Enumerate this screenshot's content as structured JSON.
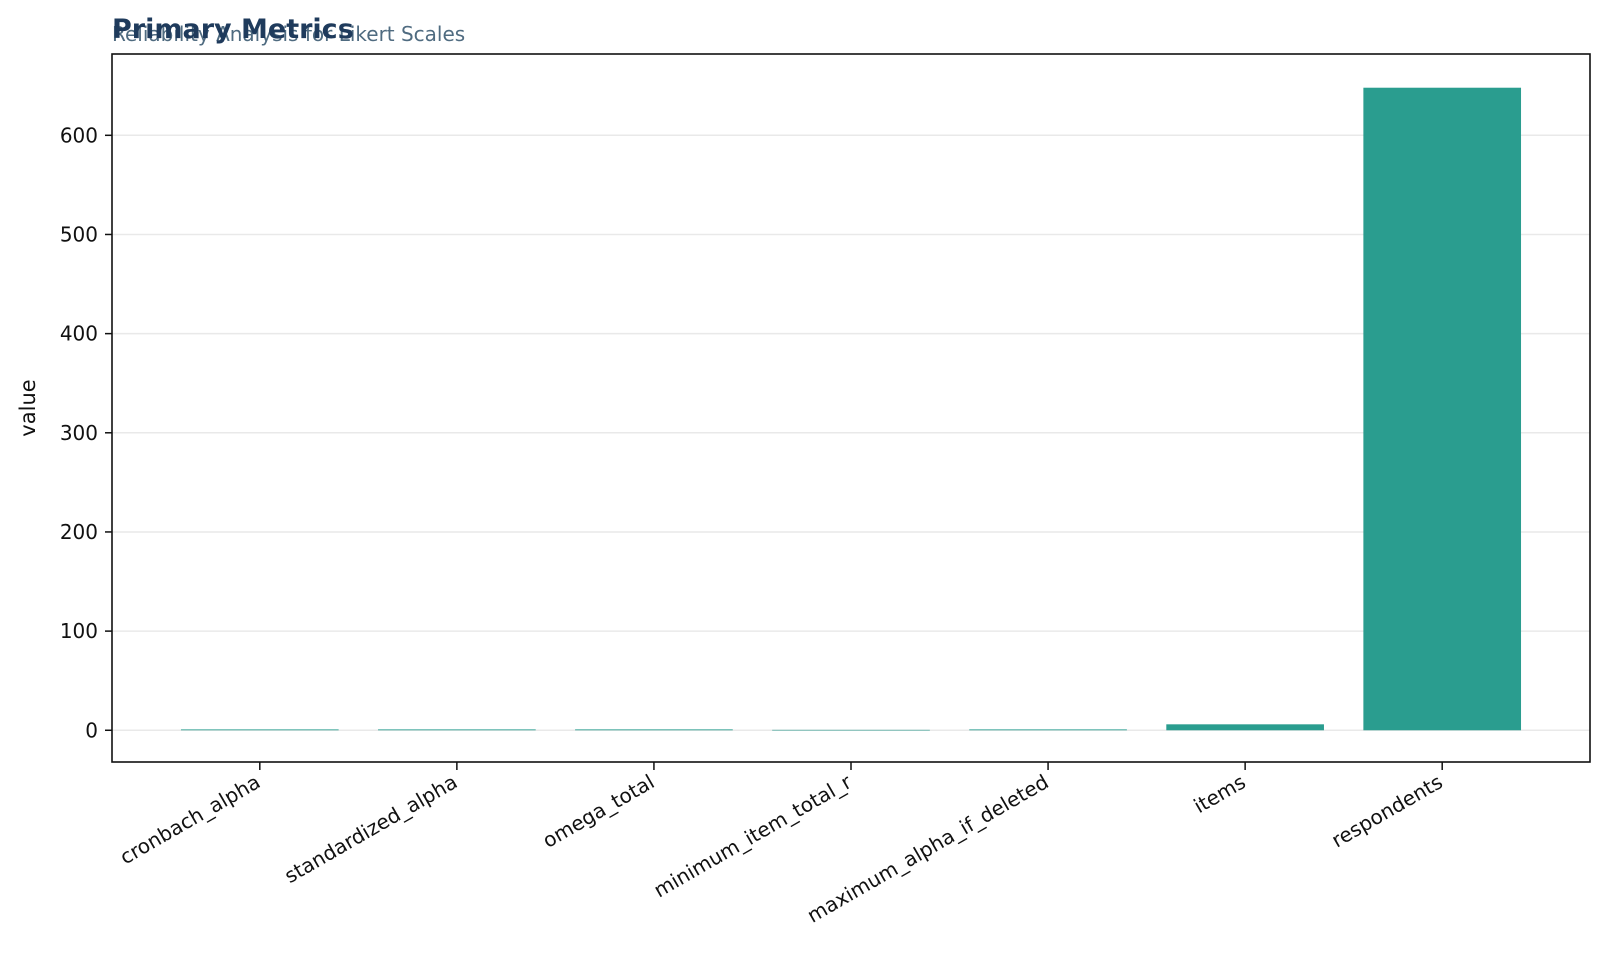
{
  "chart_data": {
    "type": "bar",
    "title": "Primary Metrics",
    "subtitle": "Reliability Analysis for Likert Scales",
    "xlabel": "",
    "ylabel": "value",
    "categories": [
      "cronbach_alpha",
      "standardized_alpha",
      "omega_total",
      "minimum_item_total_r",
      "maximum_alpha_if_deleted",
      "items",
      "respondents"
    ],
    "values": [
      0.87,
      0.88,
      0.89,
      0.42,
      0.88,
      6,
      648
    ],
    "ylim": [
      -32,
      682
    ],
    "yticks": [
      0,
      100,
      200,
      300,
      400,
      500,
      600
    ],
    "bar_color": "#2a9d8f",
    "grid": true,
    "legend": "none"
  }
}
